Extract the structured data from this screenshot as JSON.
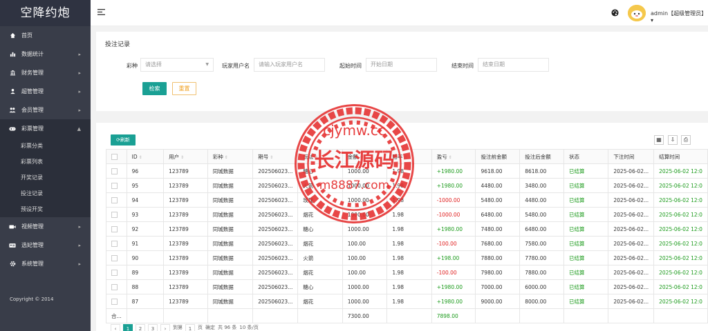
{
  "app": {
    "title": "空降约炮",
    "copyright": "Copyright © 2014"
  },
  "sidebar": {
    "items": [
      {
        "label": "首页",
        "icon": "home-icon",
        "arrow": false
      },
      {
        "label": "数据统计",
        "icon": "bar-chart-icon",
        "arrow": true
      },
      {
        "label": "财务管理",
        "icon": "bank-icon",
        "arrow": true
      },
      {
        "label": "超管管理",
        "icon": "user-icon",
        "arrow": true
      },
      {
        "label": "会员管理",
        "icon": "users-icon",
        "arrow": true
      },
      {
        "label": "彩票管理",
        "icon": "gamepad-icon",
        "arrow": true,
        "open": true
      },
      {
        "label": "视频管理",
        "icon": "video-icon",
        "arrow": true
      },
      {
        "label": "选妃管理",
        "icon": "id-card-icon",
        "arrow": true
      },
      {
        "label": "系统管理",
        "icon": "gear-icon",
        "arrow": true
      }
    ],
    "sub_items": [
      "彩票分类",
      "彩票列表",
      "开奖记录",
      "投注记录",
      "预设开奖"
    ]
  },
  "header": {
    "user": "admin【超级管理员】",
    "arrow": "▾"
  },
  "search": {
    "title": "投注记录",
    "lottery_label": "彩种",
    "lottery_placeholder": "请选择",
    "player_label": "玩家用户名",
    "player_placeholder": "请输入玩家用户名",
    "start_label": "起始时间",
    "start_placeholder": "开始日期",
    "end_label": "结束时间",
    "end_placeholder": "结束日期",
    "search_btn": "检索",
    "reset_btn": "重置"
  },
  "table": {
    "refresh_btn": "刷新",
    "columns": [
      "ID",
      "用户",
      "彩种",
      "期号",
      "玩法",
      "金额",
      "赔率",
      "盈亏",
      "投注前金额",
      "投注后金额",
      "状态",
      "下注时间",
      "结算时间"
    ],
    "rows": [
      {
        "id": "96",
        "user": "123789",
        "lottery": "同城数据",
        "issue": "202506023...",
        "play": "糖心",
        "amount": "1000.00",
        "odds": "1.98",
        "profit": "+1980.00",
        "before": "9618.00",
        "after": "8618.00",
        "status": "已结算",
        "bet_time": "2025-06-02...",
        "settle_time": "2025-06-02 12:0"
      },
      {
        "id": "95",
        "user": "123789",
        "lottery": "同城数据",
        "issue": "202506023...",
        "play": "火箭",
        "amount": "1000.00",
        "odds": "1.98",
        "profit": "+1980.00",
        "before": "4480.00",
        "after": "3480.00",
        "status": "已结算",
        "bet_time": "2025-06-02...",
        "settle_time": "2025-06-02 12:0"
      },
      {
        "id": "94",
        "user": "123789",
        "lottery": "同城数据",
        "issue": "202506023...",
        "play": "玫瑰",
        "amount": "1000.00",
        "odds": "1.98",
        "profit": "-1000.00",
        "before": "5480.00",
        "after": "4480.00",
        "status": "已结算",
        "bet_time": "2025-06-02...",
        "settle_time": "2025-06-02 12:0"
      },
      {
        "id": "93",
        "user": "123789",
        "lottery": "同城数据",
        "issue": "202506023...",
        "play": "烟花",
        "amount": "1000.00",
        "odds": "1.98",
        "profit": "-1000.00",
        "before": "6480.00",
        "after": "5480.00",
        "status": "已结算",
        "bet_time": "2025-06-02...",
        "settle_time": "2025-06-02 12:0"
      },
      {
        "id": "92",
        "user": "123789",
        "lottery": "同城数据",
        "issue": "202506023...",
        "play": "糖心",
        "amount": "1000.00",
        "odds": "1.98",
        "profit": "+1980.00",
        "before": "7480.00",
        "after": "6480.00",
        "status": "已结算",
        "bet_time": "2025-06-02...",
        "settle_time": "2025-06-02 12:0"
      },
      {
        "id": "91",
        "user": "123789",
        "lottery": "同城数据",
        "issue": "202506023...",
        "play": "烟花",
        "amount": "100.00",
        "odds": "1.98",
        "profit": "-100.00",
        "before": "7680.00",
        "after": "7580.00",
        "status": "已结算",
        "bet_time": "2025-06-02...",
        "settle_time": "2025-06-02 12:0"
      },
      {
        "id": "90",
        "user": "123789",
        "lottery": "同城数据",
        "issue": "202506023...",
        "play": "火箭",
        "amount": "100.00",
        "odds": "1.98",
        "profit": "+198.00",
        "before": "7880.00",
        "after": "7780.00",
        "status": "已结算",
        "bet_time": "2025-06-02...",
        "settle_time": "2025-06-02 12:0"
      },
      {
        "id": "89",
        "user": "123789",
        "lottery": "同城数据",
        "issue": "202506023...",
        "play": "烟花",
        "amount": "100.00",
        "odds": "1.98",
        "profit": "-100.00",
        "before": "7980.00",
        "after": "7880.00",
        "status": "已结算",
        "bet_time": "2025-06-02...",
        "settle_time": "2025-06-02 12:0"
      },
      {
        "id": "88",
        "user": "123789",
        "lottery": "同城数据",
        "issue": "202506023...",
        "play": "糖心",
        "amount": "1000.00",
        "odds": "1.98",
        "profit": "+1980.00",
        "before": "7000.00",
        "after": "6000.00",
        "status": "已结算",
        "bet_time": "2025-06-02...",
        "settle_time": "2025-06-02 12:0"
      },
      {
        "id": "87",
        "user": "123789",
        "lottery": "同城数据",
        "issue": "202506023...",
        "play": "烟花",
        "amount": "1000.00",
        "odds": "1.98",
        "profit": "+1980.00",
        "before": "9000.00",
        "after": "8000.00",
        "status": "已结算",
        "bet_time": "2025-06-02...",
        "settle_time": "2025-06-02 12:0"
      }
    ],
    "total_label": "合...",
    "total_amount": "7300.00",
    "total_profit": "7898.00"
  },
  "watermark": {
    "line1": "cjymw.cc",
    "line2": "长江源码",
    "line3": "m8887.com"
  },
  "pagination": {
    "pages": [
      "1",
      "2",
      "3"
    ],
    "goto_label": "到第",
    "page_unit": "页",
    "confirm": "确定",
    "total": "共 96 条",
    "per_page": "10 条/页"
  },
  "colors": {
    "sidebar": "#393d49",
    "accent": "#1aa094",
    "positive": "#1a9a1a",
    "negative": "#e02020",
    "watermark": "#e52e2e"
  }
}
